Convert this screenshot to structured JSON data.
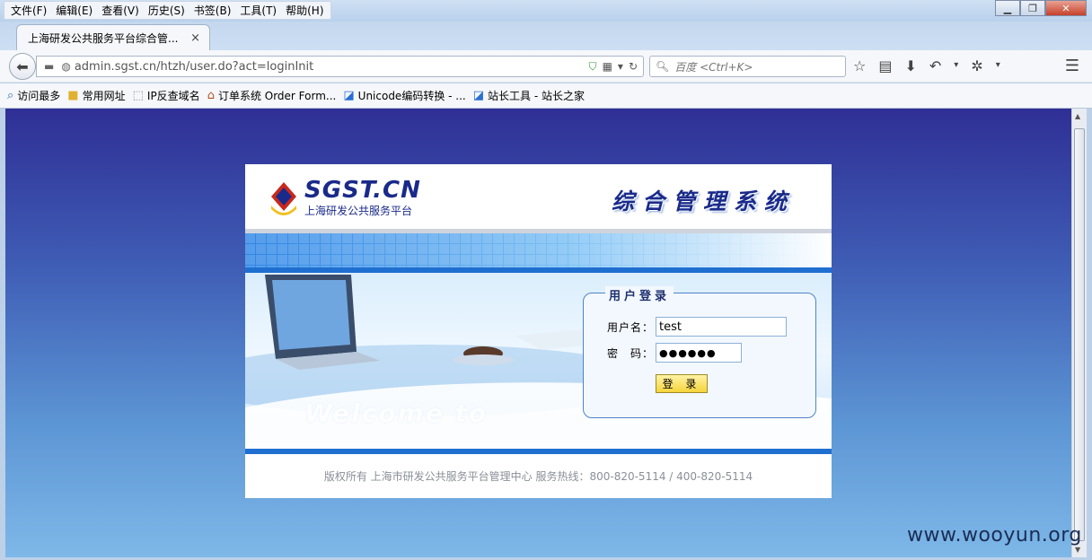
{
  "menu": [
    "文件(F)",
    "编辑(E)",
    "查看(V)",
    "历史(S)",
    "书签(B)",
    "工具(T)",
    "帮助(H)"
  ],
  "tab": {
    "title": "上海研发公共服务平台综合管...",
    "close": "×",
    "new": "+"
  },
  "nav": {
    "url": "admin.sgst.cn/htzh/user.do?act=loginInit",
    "search_engine": "百度",
    "search_placeholder": "<Ctrl+K>"
  },
  "bookmarks": [
    "访问最多",
    "常用网址",
    "IP反查域名",
    "订单系统 Order Form...",
    "Unicode编码转换 - ...",
    "站长工具 - 站长之家"
  ],
  "page": {
    "logo_main": "SGST.CN",
    "logo_sub": "上海研发公共服务平台",
    "system_title": "综合管理系统",
    "welcome": "Welcome to",
    "login": {
      "legend": "用户登录",
      "username_label": "用户名：",
      "username_value": "test",
      "password_label": "密　码：",
      "password_mask": "●●●●●●",
      "button": "登 录"
    },
    "footer": "版权所有 上海市研发公共服务平台管理中心 服务热线：800-820-5114 / 400-820-5114"
  },
  "watermark": "www.wooyun.org",
  "colors": {
    "brand": "#1a2a8a",
    "band": "#1f6fd1",
    "button": "#f5d43b"
  }
}
